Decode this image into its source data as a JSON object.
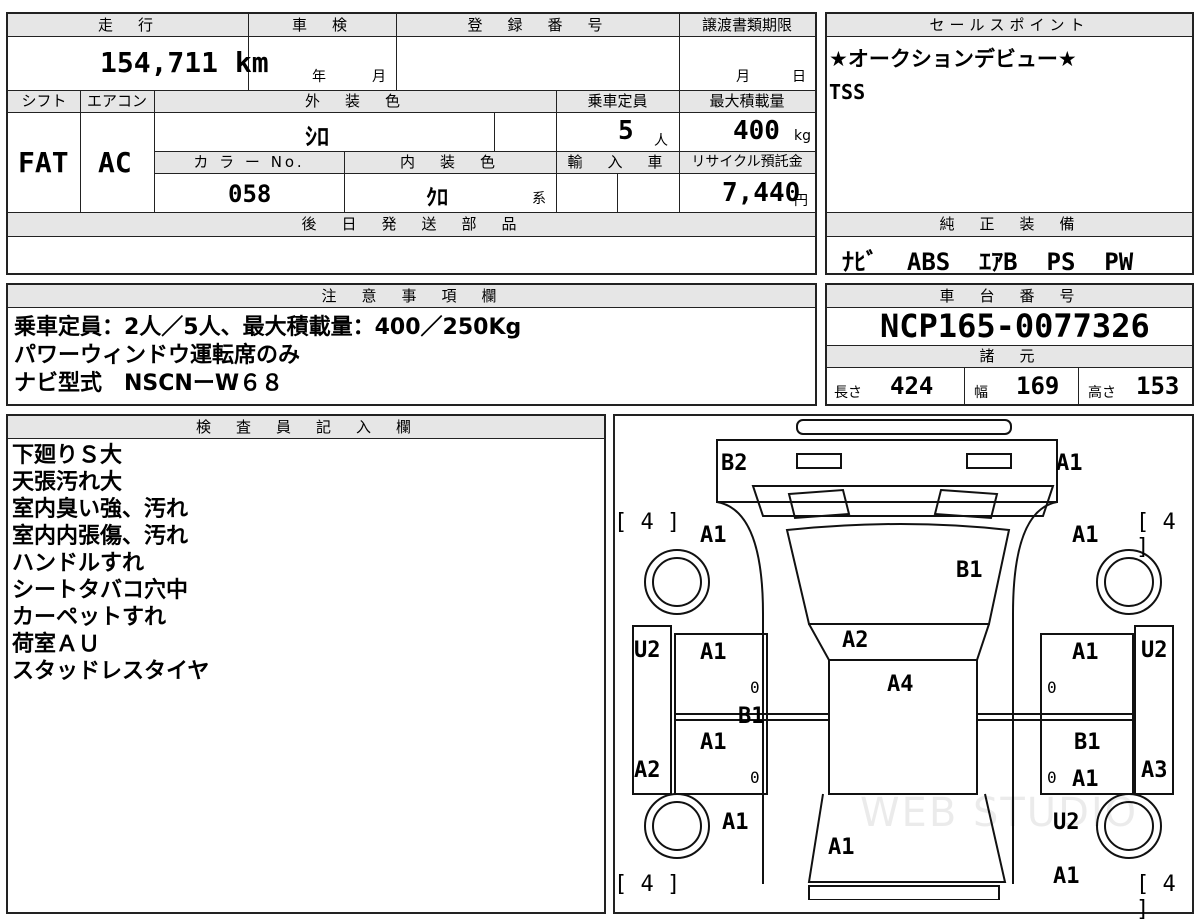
{
  "header": {
    "mileage_label": "走　行",
    "mileage_value": "154,711 km",
    "inspection_label": "車　検",
    "inspection_year": "年",
    "inspection_month": "月",
    "registration_label": "登　録　番　号",
    "transfer_label": "譲渡書類期限",
    "transfer_month": "月",
    "transfer_day": "日"
  },
  "specs": {
    "shift_label": "シフト",
    "shift_value": "FAT",
    "ac_label": "エアコン",
    "ac_value": "AC",
    "exterior_label": "外　装　色",
    "exterior_value": "ｼﾛ",
    "capacity_label": "乗車定員",
    "capacity_value": "5",
    "capacity_unit": "人",
    "load_label": "最大積載量",
    "load_value": "400",
    "load_unit": "kg",
    "color_no_label": "カ ラ ー No.",
    "color_no_value": "058",
    "interior_label": "内　装　色",
    "interior_value": "ｸﾛ",
    "interior_suffix": "系",
    "import_label": "輸　入　車",
    "recycle_label": "リサイクル預託金",
    "recycle_value": "7,440",
    "recycle_unit": "円",
    "later_parts_label": "後　日　発　送　部　品"
  },
  "sales": {
    "title": "セールスポイント",
    "line1": "★オークションデビュー★",
    "line2": "TSS"
  },
  "equipment": {
    "title": "純　正　装　備",
    "value": "ﾅﾋﾞ  ABS  ｴｱB  PS  PW"
  },
  "notes": {
    "title": "注　意　事　項　欄",
    "lines": [
      "乗車定員：2人／5人、最大積載量：400／250Kg",
      "パワーウィンドウ運転席のみ",
      "ナビ型式　NSCNーW６８"
    ]
  },
  "chassis": {
    "title": "車　台　番　号",
    "value": "NCP165-0077326",
    "dims_title": "諸　元",
    "length_label": "長さ",
    "length_value": "424",
    "width_label": "幅",
    "width_value": "169",
    "height_label": "高さ",
    "height_value": "153"
  },
  "inspector": {
    "title": "検　査　員　記　入　欄",
    "lines": [
      "下廻りＳ大",
      "天張汚れ大",
      "室内臭い強、汚れ",
      "室内内張傷、汚れ",
      "ハンドルすれ",
      "シートタバコ穴中",
      "カーペットすれ",
      "荷室ＡＵ",
      "スタッドレスタイヤ"
    ]
  },
  "diagram": {
    "marks": {
      "rear_left": "B2",
      "rear_right": "A1",
      "tire_rl": "[ 4 ]",
      "tire_rr": "[ 4 ]",
      "tire_fl": "[ 4 ]",
      "tire_fr": "[ 4 ]",
      "rear_quarter_left": "A1",
      "rear_quarter_right": "A1",
      "roof": "B1",
      "rear_pillar_left": "U2",
      "rear_pillar_right": "U2",
      "rear_door_left": "A1",
      "rear_door_right": "A1",
      "roof_front": "A2",
      "windshield_area": "A4",
      "center_pillar_left": "B1",
      "front_door_left": "A1",
      "front_door_right": "B1",
      "front_pillar_left": "A2",
      "front_pillar_right": "A3",
      "front_door_right2": "A1",
      "front_fender_left": "A1",
      "front_fender_right": "U2",
      "hood": "A1",
      "front_bumper_right": "A1",
      "zero": "0"
    },
    "watermark": "WEB STUDIO"
  }
}
